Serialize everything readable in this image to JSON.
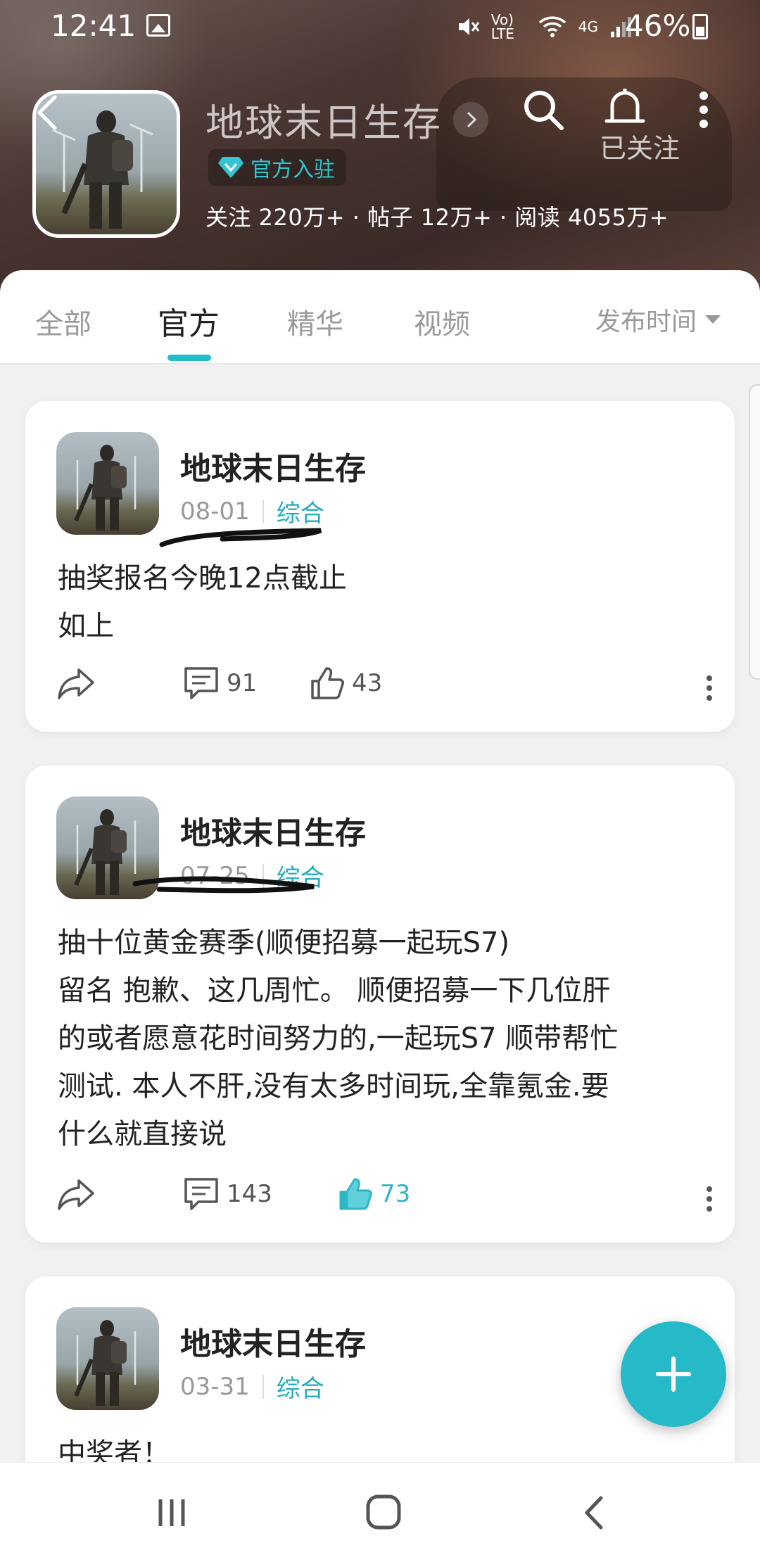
{
  "status_bar": {
    "time": "12:41",
    "icons_text": [
      "Vo) LTE",
      "4G"
    ],
    "battery": "46%"
  },
  "header": {
    "title": "地球末日生存",
    "official_badge": "官方入驻",
    "stats": "关注 220万+ · 帖子 12万+ · 阅读 4055万+",
    "follow_state": "已关注"
  },
  "tabs": [
    {
      "label": "全部"
    },
    {
      "label": "官方"
    },
    {
      "label": "精华"
    },
    {
      "label": "视频"
    }
  ],
  "active_tab": "官方",
  "sort": {
    "label": "发布时间"
  },
  "posts": [
    {
      "author": "地球末日生存",
      "date": "08-01",
      "category": "综合",
      "lines": [
        "抽奖报名今晚12点截止",
        "如上"
      ],
      "comments": "91",
      "likes": "43",
      "liked": false
    },
    {
      "author": "地球末日生存",
      "date": "07-25",
      "category": "综合",
      "lines": [
        "抽十位黄金赛季(顺便招募一起玩S7)",
        "留名 抱歉、这几周忙。 顺便招募一下几位肝",
        "的或者愿意花时间努力的,一起玩S7 顺带帮忙",
        "测试. 本人不肝,没有太多时间玩,全靠氪金.要",
        "什么就直接说"
      ],
      "comments": "143",
      "likes": "73",
      "liked": true
    },
    {
      "author": "地球末日生存",
      "date": "03-31",
      "category": "综合",
      "lines": [
        "中奖者！"
      ]
    }
  ],
  "colors": {
    "accent": "#24bdc8",
    "like_active": "#2fb6c6",
    "header_bg": "#4a3632"
  },
  "icons": [
    "back-icon",
    "search-icon",
    "bell-icon",
    "more-vertical-icon",
    "diamond-icon",
    "share-icon",
    "comment-icon",
    "thumbs-up-icon",
    "plus-icon",
    "recent-apps-icon",
    "home-icon",
    "nav-back-icon"
  ]
}
